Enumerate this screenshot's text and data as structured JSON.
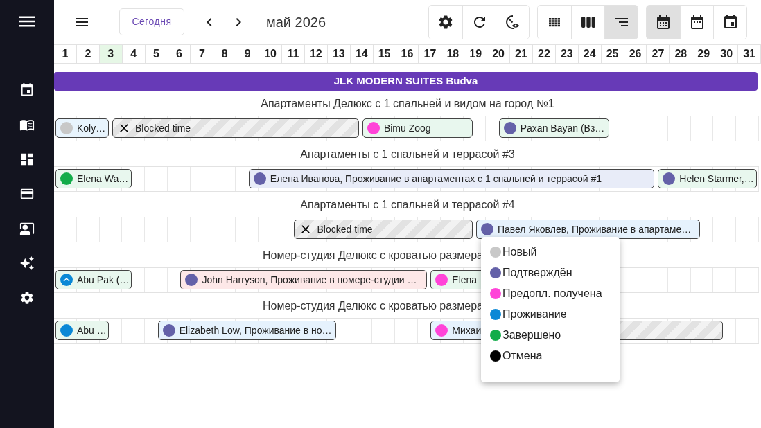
{
  "sidebar": {
    "items": [
      {
        "kind": "menu"
      },
      {
        "kind": "calendar"
      },
      {
        "kind": "book"
      },
      {
        "kind": "dashboard"
      },
      {
        "kind": "card"
      },
      {
        "kind": "presentation"
      },
      {
        "kind": "sparkles"
      },
      {
        "kind": "settings"
      }
    ]
  },
  "toolbar": {
    "today_button": "Сегодня",
    "month": "май 2026",
    "button_groups": [
      {
        "buttons": [
          {
            "kind": "settings",
            "selected": false
          },
          {
            "kind": "refresh",
            "selected": false
          },
          {
            "kind": "visibility",
            "selected": false
          }
        ]
      },
      {
        "buttons": [
          {
            "kind": "grid",
            "selected": false
          },
          {
            "kind": "columns",
            "selected": false
          },
          {
            "kind": "timeline",
            "selected": true
          }
        ]
      },
      {
        "buttons": [
          {
            "kind": "month",
            "selected": true
          },
          {
            "kind": "week",
            "selected": false
          },
          {
            "kind": "day",
            "selected": false
          }
        ]
      }
    ]
  },
  "days": [
    {
      "label": "1",
      "today": false
    },
    {
      "label": "2",
      "today": false
    },
    {
      "label": "3",
      "today": true
    },
    {
      "label": "4",
      "today": false
    },
    {
      "label": "5",
      "today": false
    },
    {
      "label": "6",
      "today": false
    },
    {
      "label": "7",
      "today": false
    },
    {
      "label": "8",
      "today": false
    },
    {
      "label": "9",
      "today": false
    },
    {
      "label": "10",
      "today": false
    },
    {
      "label": "11",
      "today": false
    },
    {
      "label": "12",
      "today": false
    },
    {
      "label": "13",
      "today": false
    },
    {
      "label": "14",
      "today": false
    },
    {
      "label": "15",
      "today": false
    },
    {
      "label": "16",
      "today": false
    },
    {
      "label": "17",
      "today": false
    },
    {
      "label": "18",
      "today": false
    },
    {
      "label": "19",
      "today": false
    },
    {
      "label": "20",
      "today": false
    },
    {
      "label": "21",
      "today": false
    },
    {
      "label": "22",
      "today": false
    },
    {
      "label": "23",
      "today": false
    },
    {
      "label": "24",
      "today": false
    },
    {
      "label": "25",
      "today": false
    },
    {
      "label": "26",
      "today": false
    },
    {
      "label": "27",
      "today": false
    },
    {
      "label": "28",
      "today": false
    },
    {
      "label": "29",
      "today": false
    },
    {
      "label": "30",
      "today": false
    },
    {
      "label": "31",
      "today": false
    }
  ],
  "property": "JLK MODERN SUITES Budva",
  "rooms": [
    {
      "title": "Апартаменты Делюкс с 1 спальней и видом на город №1",
      "bookings": [
        {
          "kind": "reservation",
          "label": "Koly…",
          "dot": {
            "color": "#c8c8c8"
          },
          "bar": {
            "color": "#e8f4fd"
          },
          "checked_in_mark": false
        },
        {
          "kind": "blocked",
          "label": "Blocked time"
        },
        {
          "kind": "reservation",
          "label": "Bimu Zoog",
          "dot": {
            "color": "#ff44d8"
          },
          "bar": {
            "color": "#e8f7ee"
          },
          "checked_in_mark": false
        },
        {
          "kind": "reservation",
          "label": "Paxan Bayan (Вз…",
          "dot": {
            "color": "#6461a8"
          },
          "bar": {
            "color": "#e8f7ee"
          },
          "checked_in_mark": false
        }
      ]
    },
    {
      "title": "Апартаменты с 1 спальней и террасой #3",
      "bookings": [
        {
          "kind": "reservation",
          "label": "Elena Wa…",
          "dot": {
            "color": "#13ac4a"
          },
          "bar": {
            "color": "#e8f7ee"
          },
          "checked_in_mark": false
        },
        {
          "kind": "reservation",
          "label": "Елена Иванова, Проживание в апартаментах с 1 спальней и террасой #1",
          "dot": {
            "color": "#6461a8"
          },
          "bar": {
            "color": "#e8ecf8"
          },
          "checked_in_mark": false
        },
        {
          "kind": "reservation",
          "label": "Helen Starmer,…",
          "dot": {
            "color": "#6461a8"
          },
          "bar": {
            "color": "#e8f7ee"
          },
          "checked_in_mark": false
        }
      ]
    },
    {
      "title": "Апартаменты с 1 спальней и террасой #4",
      "bookings": [
        {
          "kind": "blocked",
          "label": "Blocked time"
        },
        {
          "kind": "reservation",
          "label": "Павел Яковлев, Проживание в апартаме…",
          "dot": {
            "color": "#6461a8"
          },
          "bar": {
            "color": "#e6f2fd"
          },
          "checked_in_mark": false
        }
      ]
    },
    {
      "title": "Номер-студия Делюкс с кроватью размера",
      "bookings": [
        {
          "kind": "reservation",
          "label": "Abu Pak (…",
          "dot": {
            "color": "#0a88d6"
          },
          "bar": {
            "color": "#e8f7ee"
          },
          "checked_in_mark": true
        },
        {
          "kind": "reservation",
          "label": "John Harryson, Проживание в номере-студии …",
          "dot": {
            "color": "#6461a8"
          },
          "bar": {
            "color": "#fde8e8"
          },
          "checked_in_mark": false
        },
        {
          "kind": "reservation",
          "label": "Elena",
          "dot": {
            "color": "#ff44d8"
          },
          "bar": {
            "color": "#e8f7ee"
          },
          "checked_in_mark": false
        }
      ]
    },
    {
      "title": "Номер-студия Делюкс с кроватью размера",
      "bookings": [
        {
          "kind": "reservation",
          "label": "Abu …",
          "dot": {
            "color": "#0a88d6"
          },
          "bar": {
            "color": "#e8f7ee"
          },
          "checked_in_mark": false
        },
        {
          "kind": "reservation",
          "label": "Elizabeth Low, Проживание в но…",
          "dot": {
            "color": "#6461a8"
          },
          "bar": {
            "color": "#e6f2fd"
          },
          "checked_in_mark": false
        },
        {
          "kind": "reservation",
          "label": "Михаи",
          "dot": {
            "color": "#ff44d8"
          },
          "bar": {
            "color": "#e6f2fd"
          },
          "checked_in_mark": false
        },
        {
          "kind": "blocked"
        }
      ]
    }
  ],
  "status_legend": [
    {
      "label": "Новый",
      "color": "#c8c8c8"
    },
    {
      "label": "Подтверждён",
      "color": "#6461a8"
    },
    {
      "label": "Предопл. получена",
      "color": "#ff44d8"
    },
    {
      "label": "Проживание",
      "color": "#0a88d6"
    },
    {
      "label": "Завершено",
      "color": "#13ac4a"
    },
    {
      "label": "Отмена",
      "color": "#000000"
    }
  ]
}
